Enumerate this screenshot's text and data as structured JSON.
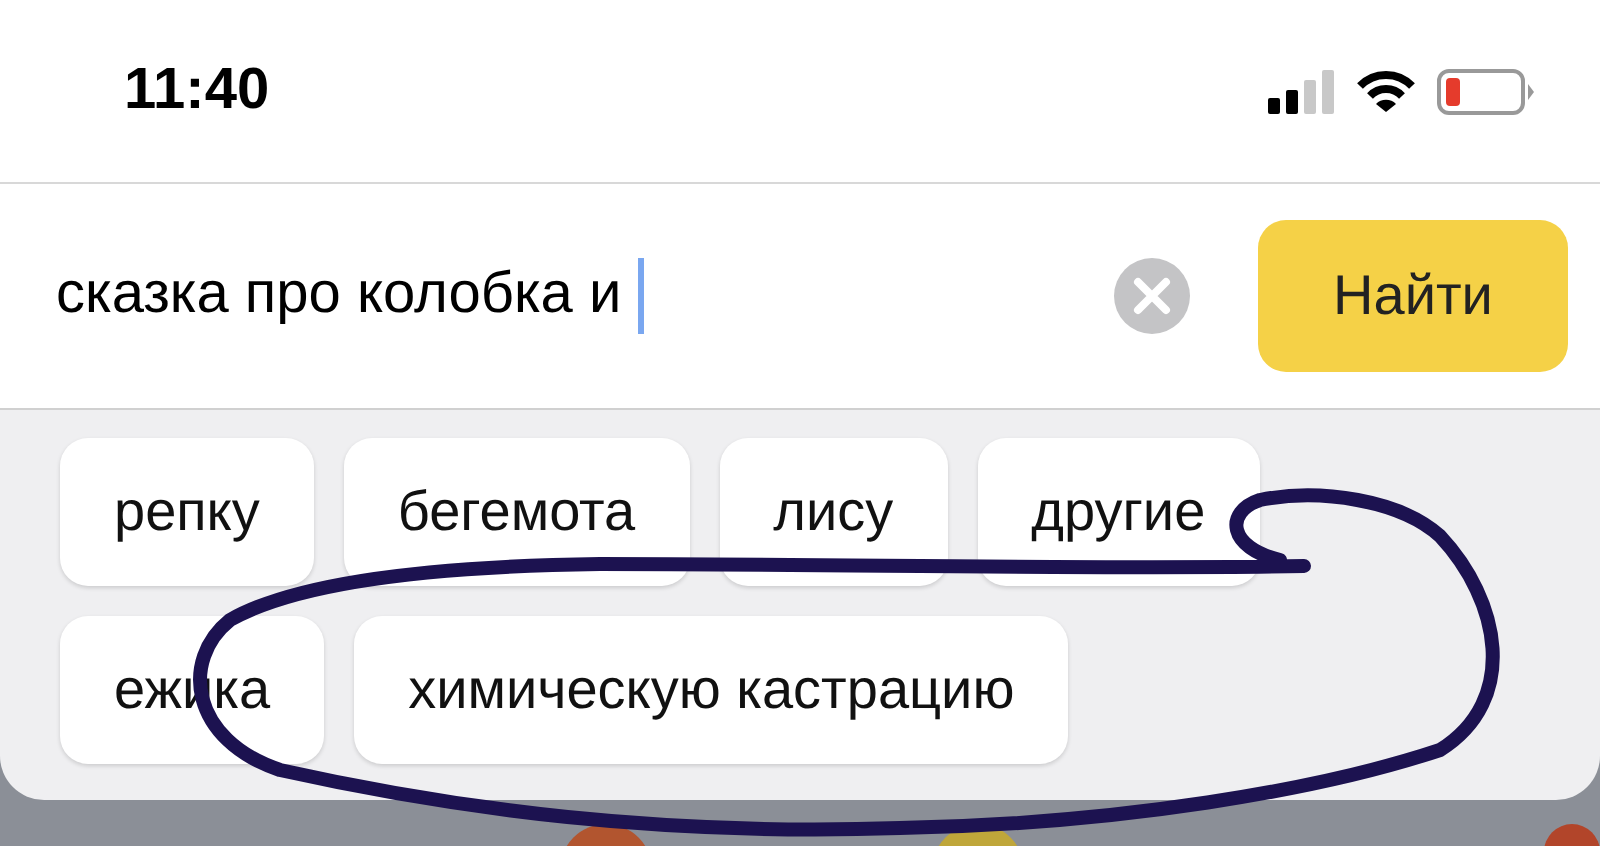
{
  "status_bar": {
    "time": "11:40"
  },
  "search": {
    "value": "сказка про колобка и",
    "button": "Найти"
  },
  "suggestions": [
    [
      "репку",
      "бегемота",
      "лису",
      "другие"
    ],
    [
      "ежика",
      "химическую кастрацию"
    ]
  ]
}
